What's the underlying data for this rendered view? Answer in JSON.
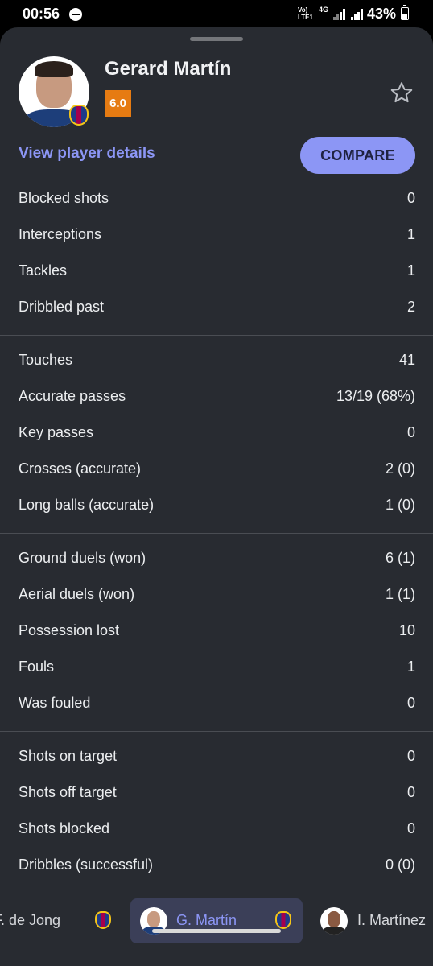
{
  "status_bar": {
    "time": "00:56",
    "network_label": "Vo) LTE1",
    "network_type": "4G",
    "battery": "43%"
  },
  "player": {
    "name": "Gerard Martín",
    "rating": "6.0",
    "rating_color": "#e67b12",
    "details_link": "View player details",
    "compare_label": "COMPARE"
  },
  "stat_groups": [
    [
      {
        "label": "Blocked shots",
        "value": "0"
      },
      {
        "label": "Interceptions",
        "value": "1"
      },
      {
        "label": "Tackles",
        "value": "1"
      },
      {
        "label": "Dribbled past",
        "value": "2"
      }
    ],
    [
      {
        "label": "Touches",
        "value": "41"
      },
      {
        "label": "Accurate passes",
        "value": "13/19 (68%)"
      },
      {
        "label": "Key passes",
        "value": "0"
      },
      {
        "label": "Crosses (accurate)",
        "value": "2 (0)"
      },
      {
        "label": "Long balls (accurate)",
        "value": "1 (0)"
      }
    ],
    [
      {
        "label": "Ground duels (won)",
        "value": "6 (1)"
      },
      {
        "label": "Aerial duels (won)",
        "value": "1 (1)"
      },
      {
        "label": "Possession lost",
        "value": "10"
      },
      {
        "label": "Fouls",
        "value": "1"
      },
      {
        "label": "Was fouled",
        "value": "0"
      }
    ],
    [
      {
        "label": "Shots on target",
        "value": "0"
      },
      {
        "label": "Shots off target",
        "value": "0"
      },
      {
        "label": "Shots blocked",
        "value": "0"
      },
      {
        "label": "Dribbles (successful)",
        "value": "0 (0)"
      }
    ]
  ],
  "player_tabs": [
    {
      "name": "F. de Jong"
    },
    {
      "name": "G. Martín",
      "active": true
    },
    {
      "name": "I. Martínez"
    }
  ],
  "colors": {
    "background": "#282b31",
    "accent": "#8c96f5"
  }
}
